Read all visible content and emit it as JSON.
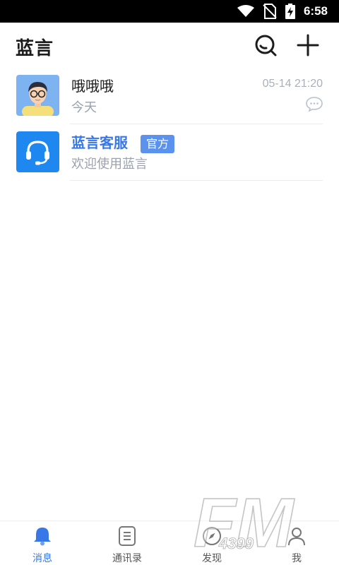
{
  "status_bar": {
    "time": "6:58"
  },
  "header": {
    "title": "蓝言"
  },
  "chats": [
    {
      "name": "哦哦哦",
      "preview": "今天",
      "time": "05-14 21:20"
    },
    {
      "name": "蓝言客服",
      "badge": "官方",
      "preview": "欢迎使用蓝言"
    }
  ],
  "tabs": [
    {
      "label": "消息"
    },
    {
      "label": "通讯录"
    },
    {
      "label": "发现"
    },
    {
      "label": "我"
    }
  ],
  "watermark": {
    "brand": "FM",
    "number": "4399"
  },
  "colors": {
    "accent": "#3777e8",
    "badge": "#5a92ee",
    "muted": "#9aa2ad"
  }
}
